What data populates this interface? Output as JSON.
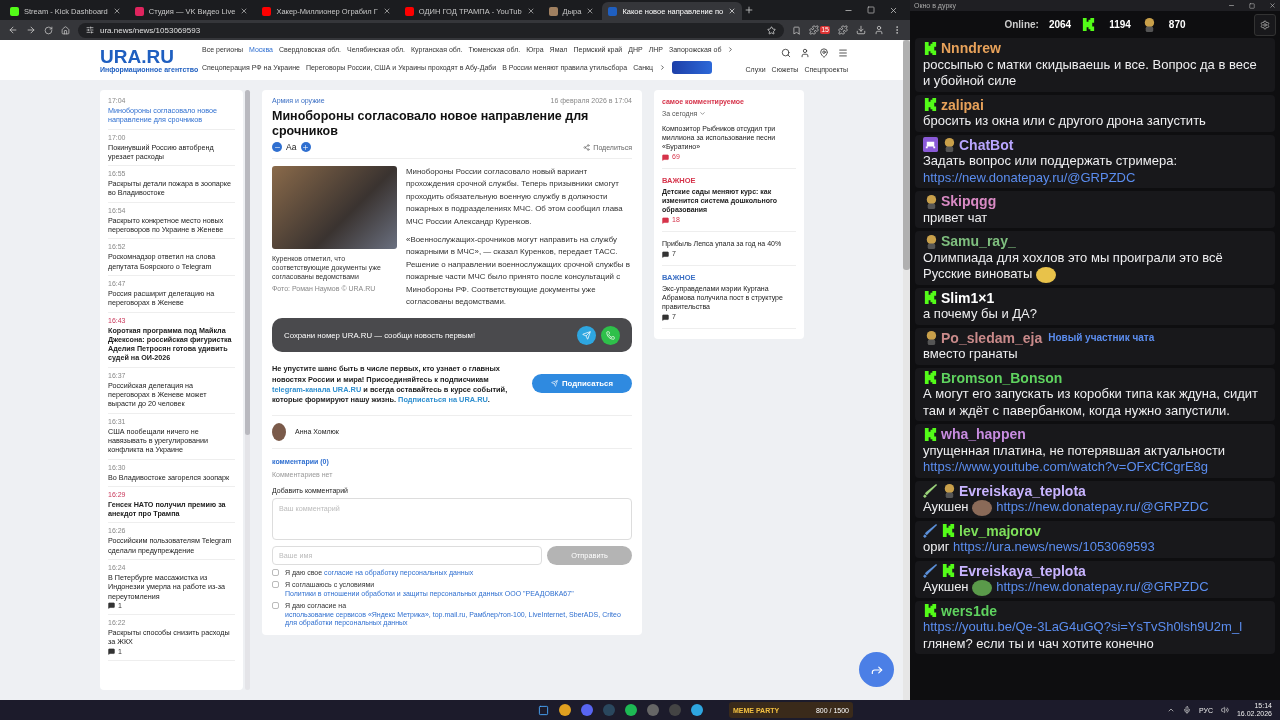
{
  "browser": {
    "tabs": [
      {
        "title": "Stream - Kick Dashboard",
        "selected": false
      },
      {
        "title": "Студия — VK Видео Live",
        "selected": false
      },
      {
        "title": "Хакер-Миллионер Ограбил Г",
        "selected": false
      },
      {
        "title": "ОДИН ГОД ТРАМПА - YouTub",
        "selected": false
      },
      {
        "title": "Дыра",
        "selected": false
      },
      {
        "title": "Какое новое направление по",
        "selected": true
      }
    ],
    "url": "ura.news/news/1053069593",
    "extension_badge": "15"
  },
  "site": {
    "logo": "URA.RU",
    "logo_subtitle": "Информационное агентство",
    "regions": [
      {
        "label": "Все регионы",
        "selected": false
      },
      {
        "label": "Москва",
        "selected": true
      },
      {
        "label": "Свердловская обл.",
        "selected": false
      },
      {
        "label": "Челябинская обл.",
        "selected": false
      },
      {
        "label": "Курганская обл.",
        "selected": false
      },
      {
        "label": "Тюменская обл.",
        "selected": false
      },
      {
        "label": "Югра",
        "selected": false
      },
      {
        "label": "Ямал",
        "selected": false
      },
      {
        "label": "Пермский край",
        "selected": false
      },
      {
        "label": "ДНР",
        "selected": false
      },
      {
        "label": "ЛНР",
        "selected": false
      },
      {
        "label": "Запорожская об",
        "selected": false
      }
    ],
    "topics": [
      "Спецоперация РФ на Украине",
      "Переговоры России, США и Украины проходят в Абу-Даби",
      "В России меняют правила утильсбора",
      "Санкц"
    ],
    "sections": [
      "Слухи",
      "Сюжеты",
      "Спецпроекты"
    ]
  },
  "news_feed": [
    {
      "time": "17:04",
      "title": "Минобороны согласовало новое направление для срочников",
      "kind": "current"
    },
    {
      "time": "17:00",
      "title": "Покинувший Россию автобренд урезает расходы",
      "kind": "regular"
    },
    {
      "time": "16:55",
      "title": "Раскрыты детали пожара в зоопарке во Владивостоке",
      "kind": "regular"
    },
    {
      "time": "16:54",
      "title": "Раскрыто конкретное место новых переговоров по Украине в Женеве",
      "kind": "regular"
    },
    {
      "time": "16:52",
      "title": "Роскомнадзор ответил на слова депутата Боярского о Telegram",
      "kind": "regular"
    },
    {
      "time": "16:47",
      "title": "Россия расширит делегацию на переговорах в Женеве",
      "kind": "regular"
    },
    {
      "time": "16:43",
      "title": "Короткая программа под Майкла Джексона: российская фигуристка Аделия Петросян готова удивить судей на ОИ-2026",
      "kind": "important"
    },
    {
      "time": "16:37",
      "title": "Российская делегация на переговорах в Женеве может вырасти до 20 человек",
      "kind": "regular"
    },
    {
      "time": "16:31",
      "title": "США пообещали ничего не навязывать в урегулировании конфликта на Украине",
      "kind": "regular"
    },
    {
      "time": "16:30",
      "title": "Во Владивостоке загорелся зоопарк",
      "kind": "regular"
    },
    {
      "time": "16:29",
      "title": "Генсек НАТО получил премию за анекдот про Трампа",
      "kind": "important"
    },
    {
      "time": "16:26",
      "title": "Российским пользователям Telegram сделали предупреждение",
      "kind": "regular"
    },
    {
      "time": "16:24",
      "title": "В Петербурге массажистка из Индонезии умерла на работе из-за переутомления",
      "kind": "regular",
      "comments": "1"
    },
    {
      "time": "16:22",
      "title": "Раскрыты способы снизить расходы за ЖКХ",
      "kind": "regular",
      "comments": "1"
    }
  ],
  "article": {
    "category": "Армия и оружие",
    "date": "16 февраля 2026 в 17:04",
    "title": "Минобороны согласовало новое направление для срочников",
    "font_label": "Аа",
    "share": "Поделиться",
    "caption": "Куренков отметил, что соответствующие документы уже согласованы ведомствами",
    "photo_credit": "Фото: Роман Наумов © URA.RU",
    "paragraphs": [
      "Минобороны России согласовало новый вариант прохождения срочной службы. Теперь призывники смогут проходить обязательную военную службу в должности пожарных в подразделениях МЧС. Об этом сообщил глава МЧС России Александр Куренков.",
      "«Военнослужащих-срочников могут направить на службу пожарными в МЧС», — сказал Куренков, передает ТАСС. Решение о направлении военнослужащих срочной службы в пожарные части МЧС было принято после консультаций с Минобороны РФ. Соответствующие документы уже согласованы ведомствами."
    ],
    "promo": "Сохрани номер URA.RU — сообщи новость первым!",
    "subscribe_text": [
      {
        "kind": "text",
        "text": "Не упустите шанс быть в числе первых, кто узнает о главных новостях России и мира! Присоединяйтесь к подписчикам "
      },
      {
        "kind": "link",
        "text": "telegram-канала URA.RU"
      },
      {
        "kind": "text",
        "text": " и всегда оставайтесь в курсе событий, которые формируют нашу жизнь. "
      },
      {
        "kind": "link",
        "text": "Подписаться на URA.RU"
      },
      {
        "kind": "text",
        "text": "."
      }
    ],
    "subscribe_button": "Подписаться",
    "author": "Анна Хомлюк",
    "comments_title": "комментарии (0)",
    "comments_empty": "Комментариев нет",
    "add_comment": "Добавить комментарий",
    "comment_placeholder": "Ваш комментарий",
    "name_placeholder": "Ваше имя",
    "send": "Отправить",
    "consents": [
      {
        "checked": false,
        "parts": [
          {
            "kind": "text",
            "text": "Я даю свое "
          },
          {
            "kind": "link",
            "text": "согласие на обработку персональных данных"
          }
        ]
      },
      {
        "checked": false,
        "parts": [
          {
            "kind": "text",
            "text": "Я соглашаюсь с условиями "
          },
          {
            "kind": "link",
            "text": "Политики в отношении обработки и защиты персональных данных ООО \"РЕАДОВКА67\""
          }
        ]
      },
      {
        "checked": false,
        "parts": [
          {
            "kind": "text",
            "text": "Я даю согласие на "
          },
          {
            "kind": "link",
            "text": "использование сервисов «Яндекс Метрика», top.mail.ru, Рамблер/топ-100, LiveInternet, SberADS, Criteo для обработки персональных данных"
          }
        ]
      }
    ]
  },
  "most_commented": {
    "title": "самое комментируемое",
    "period": "За сегодня",
    "items": [
      {
        "title": "Композитор Рыбников отсудил три миллиона за использование песни «Буратино»",
        "bold": false,
        "count": "69",
        "hot": true
      },
      {
        "label": {
          "text": "ВАЖНОЕ",
          "color": "#d6334a"
        },
        "title": "Детские сады меняют курс: как изменится система дошкольного образования",
        "bold": true,
        "count": "18",
        "hot": true
      },
      {
        "title": "Прибыль Лепса упала за год на 40%",
        "bold": false,
        "count": "7",
        "hot": false
      },
      {
        "label": {
          "text": "ВАЖНОЕ",
          "color": "#3b6fc4"
        },
        "title": "Экс-управделами мэрии Кургана Абрамова получила пост в структуре правительства",
        "bold": false,
        "count": "7",
        "hot": false
      }
    ]
  },
  "chat": {
    "window_title": "Окно в дурку",
    "online_label": "Online:",
    "online": "2064",
    "kick_count": "1194",
    "other_count": "870",
    "messages": [
      {
        "badges": [
          {
            "kind": "kick"
          }
        ],
        "user": "Nnndrew",
        "color": "#e8a25a",
        "parts": [
          {
            "kind": "text",
            "text": "россыпью с матки скидываешь и все. Вопрос да в весе и убойной силе"
          }
        ]
      },
      {
        "badges": [
          {
            "kind": "kick"
          }
        ],
        "user": "zalipai",
        "color": "#e8a25a",
        "parts": [
          {
            "kind": "text",
            "text": "бросить из окна или с другого дрона запустить"
          }
        ]
      },
      {
        "badges": [
          {
            "kind": "bot"
          },
          {
            "kind": "face"
          }
        ],
        "user": "ChatBot",
        "color": "#b9a6ff",
        "parts": [
          {
            "kind": "text",
            "text": "Задать вопрос или поддержать стримера: "
          },
          {
            "kind": "link",
            "text": "https://new.donatepay.ru/@GRPZDC"
          }
        ]
      },
      {
        "badges": [
          {
            "kind": "face"
          }
        ],
        "user": "Skipqgg",
        "color": "#d98ac4",
        "parts": [
          {
            "kind": "text",
            "text": "привет чат"
          }
        ]
      },
      {
        "badges": [
          {
            "kind": "face"
          }
        ],
        "user": "Samu_ray_",
        "color": "#7fbf7f",
        "parts": [
          {
            "kind": "text",
            "text": "Олимпиада для хохлов это мы проиграли это всё Русские виноваты "
          },
          {
            "kind": "emote",
            "color": "#e8c24a"
          }
        ]
      },
      {
        "badges": [
          {
            "kind": "kick"
          }
        ],
        "user": "Slim1×1",
        "color": "#ffffff",
        "parts": [
          {
            "kind": "text",
            "text": "а почему бы и ДА?"
          }
        ]
      },
      {
        "badges": [
          {
            "kind": "face"
          }
        ],
        "user": "Po_sledam_eja",
        "color": "#c98a8a",
        "tag": "Новый участник чата",
        "parts": [
          {
            "kind": "text",
            "text": "вместо гранаты"
          }
        ]
      },
      {
        "badges": [
          {
            "kind": "kick"
          }
        ],
        "user": "Bromson_Bonson",
        "color": "#5fd35f",
        "parts": [
          {
            "kind": "text",
            "text": "А могут его запускать из коробки типа как ждуна, сидит там и ждёт с павербанком, когда нужно запустили."
          }
        ]
      },
      {
        "badges": [
          {
            "kind": "kick"
          }
        ],
        "user": "wha_happen",
        "color": "#c88ce0",
        "parts": [
          {
            "kind": "text",
            "text": "упущенная платина, не потерявшая актуальности "
          },
          {
            "kind": "link",
            "text": "https://www.youtube.com/watch?v=OFxCfCgrE8g"
          }
        ]
      },
      {
        "badges": [
          {
            "kind": "sword",
            "color": "#9ad27a"
          },
          {
            "kind": "face"
          }
        ],
        "user": "Evreiskaya_teplota",
        "color": "#c8b4ff",
        "parts": [
          {
            "kind": "text",
            "text": "Аукшен "
          },
          {
            "kind": "emote",
            "color": "#8a6a58"
          },
          {
            "kind": "link",
            "text": "https://new.donatepay.ru/@GRPZDC"
          }
        ]
      },
      {
        "badges": [
          {
            "kind": "sword",
            "color": "#5b8fd8"
          },
          {
            "kind": "kick"
          }
        ],
        "user": "lev_majorov",
        "color": "#7ee05a",
        "parts": [
          {
            "kind": "text",
            "text": "ориг "
          },
          {
            "kind": "link",
            "text": "https://ura.news/news/1053069593"
          }
        ]
      },
      {
        "badges": [
          {
            "kind": "sword",
            "color": "#5b8fd8"
          },
          {
            "kind": "kick"
          }
        ],
        "user": "Evreiskaya_teplota",
        "color": "#c8b4ff",
        "parts": [
          {
            "kind": "text",
            "text": "Аукшен "
          },
          {
            "kind": "emote",
            "color": "#5a9a4a"
          },
          {
            "kind": "link",
            "text": "https://new.donatepay.ru/@GRPZDC"
          }
        ]
      },
      {
        "badges": [
          {
            "kind": "kick"
          }
        ],
        "user": "wers1de",
        "color": "#5fd35f",
        "parts": [
          {
            "kind": "link",
            "text": "https://youtu.be/Qe-3LaG4uGQ?si=YsTvSh0lsh9U2m_l"
          },
          {
            "kind": "text",
            "text": "глянем? если ты и чач хотите конечно"
          }
        ]
      }
    ]
  },
  "taskbar": {
    "widget_title": "MEME PARTY",
    "widget_value": "800 / 1500",
    "language": "РУС",
    "time": "15:14",
    "date": "16.02.2026"
  }
}
